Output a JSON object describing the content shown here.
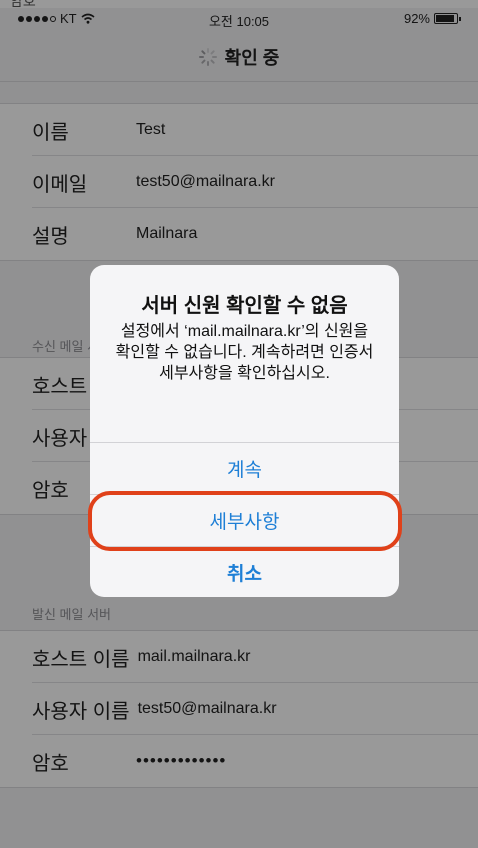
{
  "status_bar": {
    "carrier": "KT",
    "time": "오전 10:05",
    "battery": "92%",
    "battery_level": 0.92,
    "top_sliver_text": "암호"
  },
  "nav": {
    "title": "확인 중"
  },
  "account_section": {
    "rows": [
      {
        "label": "이름",
        "value": "Test"
      },
      {
        "label": "이메일",
        "value": "test50@mailnara.kr"
      },
      {
        "label": "설명",
        "value": "Mailnara"
      }
    ]
  },
  "incoming_section": {
    "header": "수신 메일 서버",
    "rows": [
      {
        "label": "호스트 이름",
        "value": ""
      },
      {
        "label": "사용자 이름",
        "value": ""
      },
      {
        "label": "암호",
        "value": ""
      }
    ]
  },
  "outgoing_section": {
    "header": "발신 메일 서버",
    "rows": [
      {
        "label": "호스트 이름",
        "value": "mail.mailnara.kr"
      },
      {
        "label": "사용자 이름",
        "value": "test50@mailnara.kr"
      },
      {
        "label": "암호",
        "value": "•••••••••••••"
      }
    ]
  },
  "alert": {
    "title": "서버 신원 확인할 수 없음",
    "message": "설정에서 ‘mail.mailnara.kr’의 신원을 확인할 수 없습니다. 계속하려면 인증서 세부사항을 확인하십시오.",
    "buttons": {
      "continue": "계속",
      "details": "세부사항",
      "cancel": "취소"
    }
  },
  "colors": {
    "accent": "#1e7fd6",
    "highlight": "#e0411a",
    "background": "#f2f2f4"
  }
}
